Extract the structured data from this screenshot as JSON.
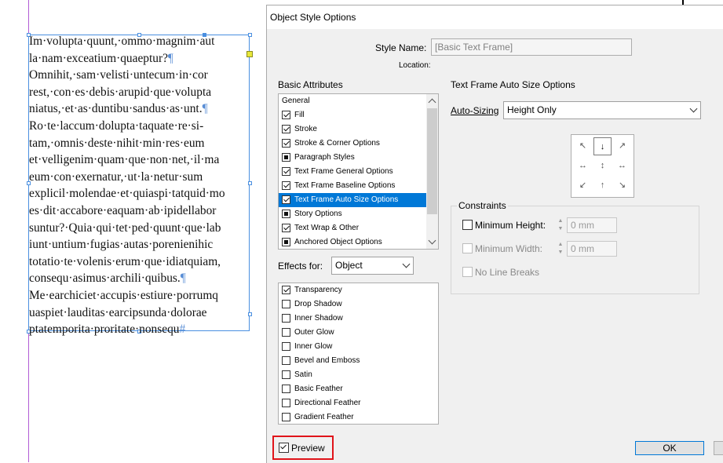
{
  "document": {
    "lines": [
      "Im·volupta·quunt,·ommo·magnim·aut",
      "la·nam·exceatium·quaeptur?",
      "Omnihit,·sam·velisti·untecum·in·cor",
      "rest,·con·es·debis·arupid·que·volupta",
      "niatus,·et·as·duntibu·sandus·as·unt.",
      "Ro·te·laccum·dolupta·taquate·re·si-",
      "tam,·omnis·deste·nihit·min·res·eum",
      "et·velligenim·quam·que·non·net,·il·ma",
      "eum·con·exernatur,·ut·la·netur·sum",
      "explicil·molendae·et·quiaspi·tatquid·mo",
      "es·dit·accabore·eaquam·ab·ipidellabor",
      "suntur?·Quia·qui·tet·ped·quunt·que·lab",
      "iunt·untium·fugias·autas·porenienihic",
      "totatio·te·volenis·erum·que·idiatquiam,",
      "consequ·asimus·archili·quibus.",
      "Me·earchiciet·accupis·estiure·porrumq",
      "uaspiet·lauditas·earcipsunda·dolorae",
      "ptatemporita·proritate·nonsequ"
    ],
    "para_mark": "¶",
    "end_mark": "#"
  },
  "dialog": {
    "title": "Object Style Options",
    "style_name_label": "Style Name:",
    "style_name_value": "[Basic Text Frame]",
    "location_label": "Location:",
    "basic_attributes_label": "Basic Attributes",
    "basic_attributes": [
      {
        "label": "General",
        "state": "header"
      },
      {
        "label": "Fill",
        "state": "checked"
      },
      {
        "label": "Stroke",
        "state": "checked"
      },
      {
        "label": "Stroke & Corner Options",
        "state": "checked"
      },
      {
        "label": "Paragraph Styles",
        "state": "filled"
      },
      {
        "label": "Text Frame General Options",
        "state": "checked"
      },
      {
        "label": "Text Frame Baseline Options",
        "state": "checked"
      },
      {
        "label": "Text Frame Auto Size Options",
        "state": "checked",
        "selected": true
      },
      {
        "label": "Story Options",
        "state": "filled"
      },
      {
        "label": "Text Wrap & Other",
        "state": "checked"
      },
      {
        "label": "Anchored Object Options",
        "state": "filled"
      }
    ],
    "effects_for_label": "Effects for:",
    "effects_for_value": "Object",
    "effects": [
      {
        "label": "Transparency",
        "state": "checked"
      },
      {
        "label": "Drop Shadow",
        "state": "empty"
      },
      {
        "label": "Inner Shadow",
        "state": "empty"
      },
      {
        "label": "Outer Glow",
        "state": "empty"
      },
      {
        "label": "Inner Glow",
        "state": "empty"
      },
      {
        "label": "Bevel and Emboss",
        "state": "empty"
      },
      {
        "label": "Satin",
        "state": "empty"
      },
      {
        "label": "Basic Feather",
        "state": "empty"
      },
      {
        "label": "Directional Feather",
        "state": "empty"
      },
      {
        "label": "Gradient Feather",
        "state": "empty"
      }
    ],
    "auto_size_section": "Text Frame Auto Size Options",
    "auto_sizing_label": "Auto-Sizing",
    "auto_sizing_value": "Height Only",
    "constraints_label": "Constraints",
    "min_height_label": "Minimum Height:",
    "min_height_value": "0 mm",
    "min_width_label": "Minimum Width:",
    "min_width_value": "0 mm",
    "no_line_breaks_label": "No Line Breaks",
    "preview_label": "Preview",
    "ok_label": "OK"
  }
}
